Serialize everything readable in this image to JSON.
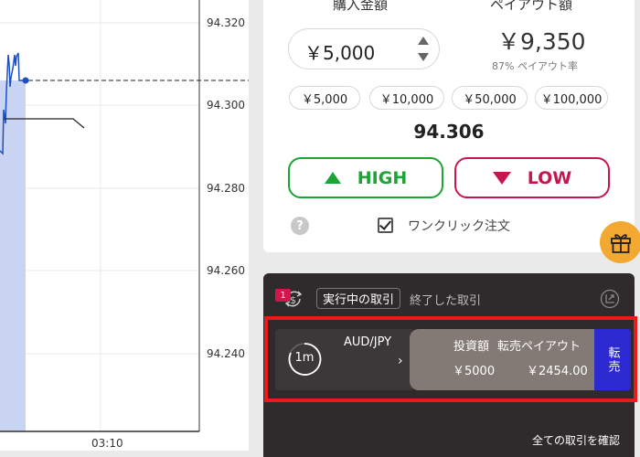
{
  "chart": {
    "price_ticks": [
      "94.320",
      "94.300",
      "94.280",
      "94.260",
      "94.240"
    ],
    "time_ticks": [
      "03:10"
    ],
    "colors": {
      "line": "#1e4fc0",
      "fill": "#c8d4f2",
      "grid": "#e8e8e8"
    }
  },
  "trade": {
    "purchase_amount_label": "購入金額",
    "payout_amount_label": "ペイアウト額",
    "amount_value": "￥5,000",
    "payout_value": "￥9,350",
    "payout_rate": "87%",
    "payout_rate_label": "ペイアウト率",
    "presets": [
      "￥5,000",
      "￥10,000",
      "￥50,000",
      "￥100,000"
    ],
    "current_price": "94.306",
    "high_label": "HIGH",
    "low_label": "LOW",
    "help_glyph": "?",
    "one_click_label": "ワンクリック注文",
    "one_click_checked": true
  },
  "positions": {
    "badge_count": "1",
    "tab_active": "実行中の取引",
    "tab_closed": "終了した取引",
    "row": {
      "expiry": "1m",
      "pair": "AUD/JPY",
      "chevron": "›",
      "investment_label": "投資額",
      "investment_value": "￥5000",
      "resale_payout_label": "転売ペイアウト",
      "resale_payout_value": "￥2454.00",
      "sell_label": "転売"
    },
    "all_trades_link": "全ての取引を確認"
  },
  "icons": {
    "stepper_up": "triangle-up-icon",
    "stepper_down": "triangle-down-icon",
    "high": "triangle-up-icon",
    "low": "heart-icon",
    "help": "question-icon",
    "gift": "gift-icon",
    "cycle": "dollar-cycle-icon",
    "export": "external-link-icon"
  },
  "colors": {
    "high": "#1ea335",
    "low": "#c5174e",
    "badge": "#d4144a",
    "sell_button": "#2c2ad0",
    "gift": "#f3a931",
    "highlight": "#ee1a1a"
  }
}
